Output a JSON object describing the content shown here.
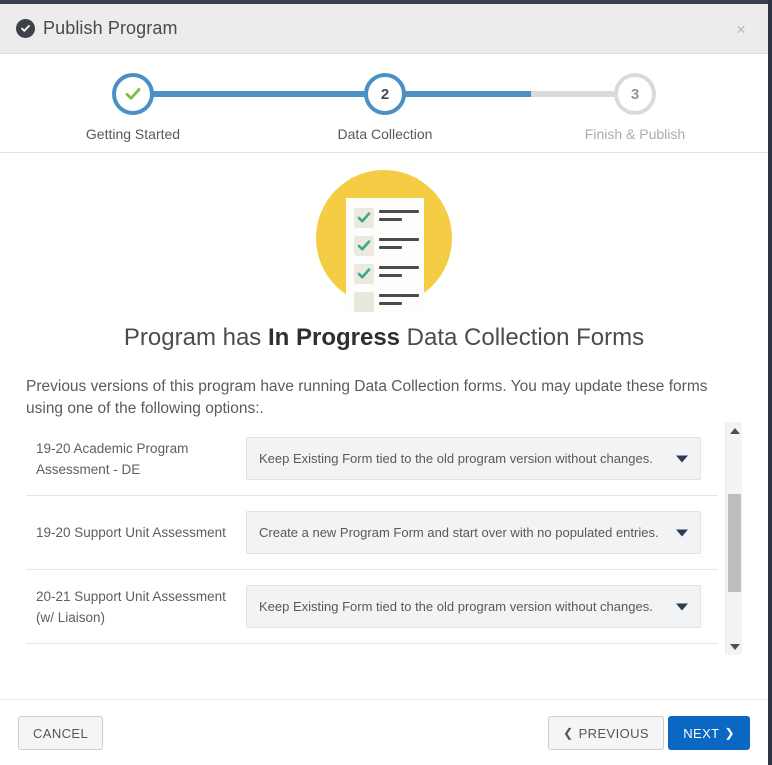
{
  "header": {
    "title": "Publish Program",
    "status_icon": "check-circle-icon",
    "close_label": "×"
  },
  "stepper": {
    "steps": [
      {
        "number": "1",
        "label": "Getting Started",
        "state": "done",
        "glyph": "check-icon"
      },
      {
        "number": "2",
        "label": "Data Collection",
        "state": "active",
        "glyph": "number"
      },
      {
        "number": "3",
        "label": "Finish & Publish",
        "state": "todo",
        "glyph": "number"
      }
    ],
    "accent_color": "#4a90c4",
    "inactive_color": "#d8dbdd",
    "check_color": "#7ac143"
  },
  "illustration": {
    "name": "checklist-illustration",
    "circle_color": "#f4cd45",
    "document_color": "#fdfdfb",
    "check_color": "#3aa98f",
    "rows_checked": 3,
    "rows_total": 4
  },
  "main": {
    "headline_before": "Program has ",
    "headline_emphasis": "In Progress",
    "headline_after": " Data Collection Forms",
    "intro": "Previous versions of this program have running Data Collection forms. You may update these forms using one of the following options:.",
    "rows": [
      {
        "label": "19-20 Academic Program Assessment - DE",
        "selected": "Keep Existing Form tied to the old program version without changes."
      },
      {
        "label": "19-20 Support Unit Assessment",
        "selected": "Create a new Program Form and start over with no populated entries."
      },
      {
        "label": "20-21 Support Unit Assessment (w/ Liaison)",
        "selected": "Keep Existing Form tied to the old program version without changes."
      }
    ],
    "scrollbar": {
      "up_icon": "chevron-up-icon",
      "down_icon": "chevron-down-icon"
    }
  },
  "footer": {
    "cancel_label": "CANCEL",
    "previous_label": "PREVIOUS",
    "next_label": "NEXT",
    "previous_icon": "❮",
    "next_icon": "❯",
    "primary_color": "#0a67c2"
  }
}
